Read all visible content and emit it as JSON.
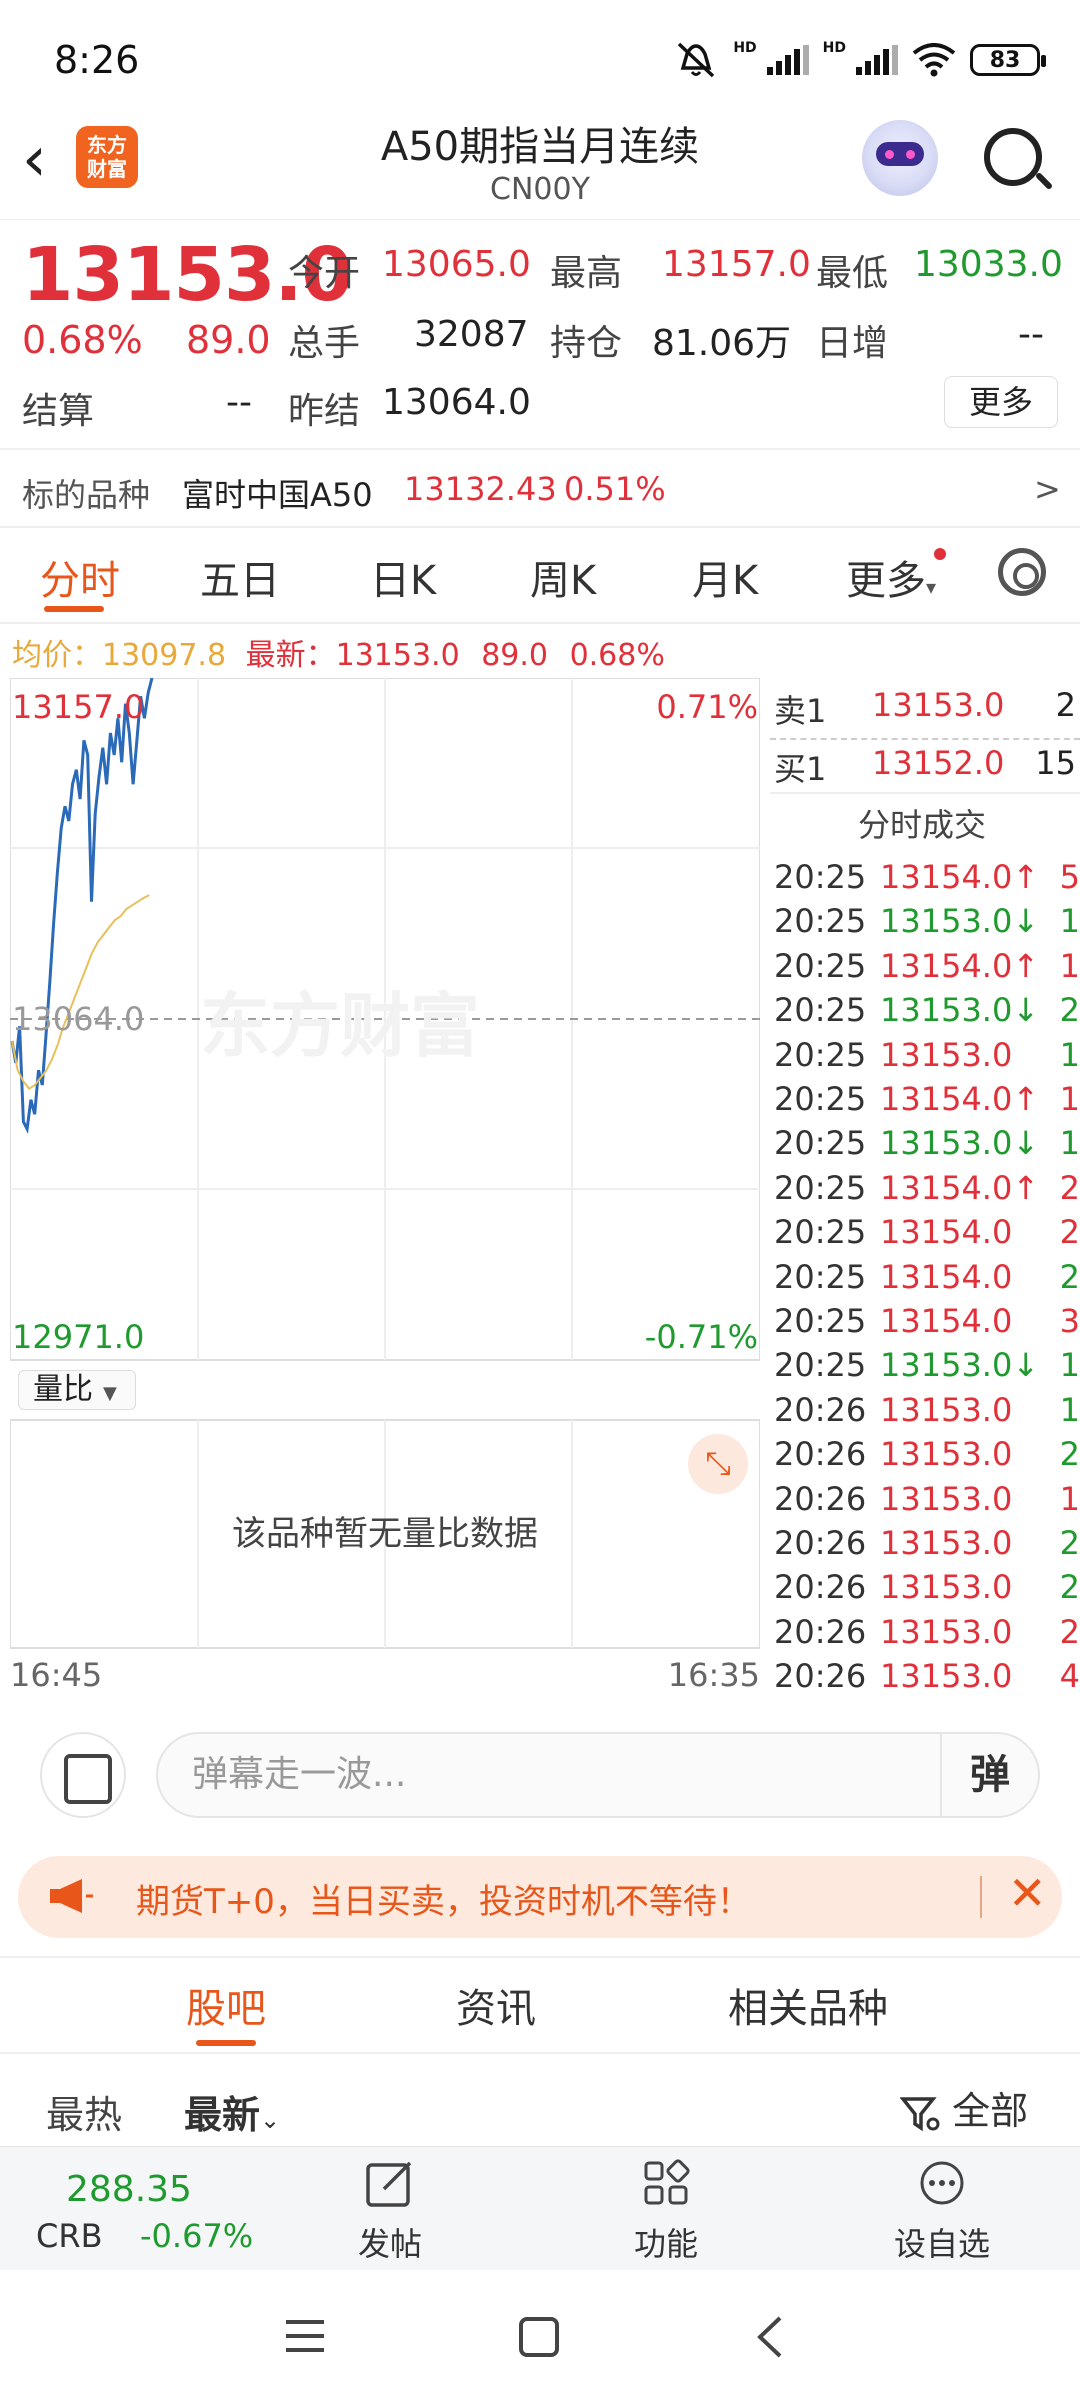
{
  "status": {
    "time": "8:26",
    "battery": "83",
    "hd1": "HD",
    "hd2": "HD"
  },
  "header": {
    "title": "A50期指当月连续",
    "code": "CN00Y",
    "logo_line1": "东方",
    "logo_line2": "财富"
  },
  "quote": {
    "price": "13153.0",
    "change_pct": "0.68%",
    "change": "89.0",
    "open_label": "今开",
    "open": "13065.0",
    "high_label": "最高",
    "high": "13157.0",
    "low_label": "最低",
    "low": "13033.0",
    "volume_label": "总手",
    "volume": "32087",
    "oi_label": "持仓",
    "oi": "81.06万",
    "daily_inc_label": "日增",
    "daily_inc": "--",
    "settle_label": "结算",
    "settle": "--",
    "prev_settle_label": "昨结",
    "prev_settle": "13064.0",
    "more_label": "更多"
  },
  "underlying": {
    "label": "标的品种",
    "name": "富时中国A50",
    "price": "13132.43",
    "pct": "0.51%",
    "arrow": ">"
  },
  "tabs": [
    "分时",
    "五日",
    "日K",
    "周K",
    "月K",
    "更多"
  ],
  "avg_line": {
    "avg_label": "均价：",
    "avg": "13097.8",
    "latest_label": "最新：",
    "latest": "13153.0",
    "chg": "89.0",
    "pct": "0.68%"
  },
  "chart": {
    "y_top": "13157.0",
    "y_top_pct": "0.71%",
    "y_mid": "13064.0",
    "y_bottom": "12971.0",
    "y_bottom_pct": "-0.71%",
    "watermark": "东方财富",
    "volume_ratio_label": "量比",
    "no_data": "该品种暂无量比数据",
    "t_start": "16:45",
    "t_end": "16:35"
  },
  "chart_data": {
    "type": "line",
    "ylim": [
      12971.0,
      13157.0
    ],
    "reference": 13064.0,
    "series": [
      {
        "values": [
          13058,
          13052,
          13062,
          13036,
          13034,
          13042,
          13038,
          13050,
          13046,
          13060,
          13074,
          13090,
          13104,
          13116,
          13122,
          13118,
          13128,
          13132,
          13124,
          13140,
          13136,
          13096,
          13120,
          13130,
          13138,
          13128,
          13142,
          13136,
          13146,
          13134,
          13150,
          13142,
          13128,
          13140,
          13152,
          13146,
          13153,
          13157
        ]
      },
      {
        "values": [
          13058,
          13050,
          13047,
          13045,
          13046,
          13048,
          13050,
          13053,
          13057,
          13062,
          13066,
          13070,
          13074,
          13078,
          13082,
          13085,
          13087,
          13089,
          13091,
          13092,
          13094,
          13095,
          13096,
          13097,
          13097.8
        ]
      }
    ]
  },
  "orderbook": [
    {
      "label": "卖1",
      "price": "13153.0",
      "qty": "2"
    },
    {
      "label": "买1",
      "price": "13152.0",
      "qty": "15"
    }
  ],
  "ticks_title": "分时成交",
  "ticks": [
    {
      "t": "20:25",
      "p": "13154.0↑",
      "v": "5",
      "c": "r"
    },
    {
      "t": "20:25",
      "p": "13153.0↓",
      "v": "1",
      "c": "g"
    },
    {
      "t": "20:25",
      "p": "13154.0↑",
      "v": "1",
      "c": "r"
    },
    {
      "t": "20:25",
      "p": "13153.0↓",
      "v": "2",
      "c": "g"
    },
    {
      "t": "20:25",
      "p": "13153.0",
      "v": "1",
      "c": "rg"
    },
    {
      "t": "20:25",
      "p": "13154.0↑",
      "v": "1",
      "c": "r"
    },
    {
      "t": "20:25",
      "p": "13153.0↓",
      "v": "1",
      "c": "g"
    },
    {
      "t": "20:25",
      "p": "13154.0↑",
      "v": "2",
      "c": "r"
    },
    {
      "t": "20:25",
      "p": "13154.0",
      "v": "2",
      "c": "r"
    },
    {
      "t": "20:25",
      "p": "13154.0",
      "v": "2",
      "c": "rg"
    },
    {
      "t": "20:25",
      "p": "13154.0",
      "v": "3",
      "c": "r"
    },
    {
      "t": "20:25",
      "p": "13153.0↓",
      "v": "1",
      "c": "g"
    },
    {
      "t": "20:26",
      "p": "13153.0",
      "v": "1",
      "c": "rg"
    },
    {
      "t": "20:26",
      "p": "13153.0",
      "v": "2",
      "c": "rg"
    },
    {
      "t": "20:26",
      "p": "13153.0",
      "v": "1",
      "c": "r"
    },
    {
      "t": "20:26",
      "p": "13153.0",
      "v": "2",
      "c": "rg"
    },
    {
      "t": "20:26",
      "p": "13153.0",
      "v": "2",
      "c": "rg"
    },
    {
      "t": "20:26",
      "p": "13153.0",
      "v": "2",
      "c": "r"
    },
    {
      "t": "20:26",
      "p": "13153.0",
      "v": "4",
      "c": "r"
    }
  ],
  "comment": {
    "placeholder": "弹幕走一波...",
    "dan": "弹"
  },
  "promo": {
    "text": "期货T+0，当日买卖，投资时机不等待！"
  },
  "bottom_tabs": [
    "股吧",
    "资讯",
    "相关品种"
  ],
  "sort": {
    "hot": "最热",
    "latest": "最新",
    "filter": "全部"
  },
  "nav": {
    "crb_value": "288.35",
    "crb_name": "CRB",
    "crb_chg": "-0.67%",
    "post": "发帖",
    "func": "功能",
    "watch": "设自选"
  },
  "colors": {
    "up": "#e0303a",
    "down": "#1f9a2e",
    "accent": "#e8561a",
    "price_line": "#2a6ab8",
    "avg_line": "#e8c05a"
  }
}
